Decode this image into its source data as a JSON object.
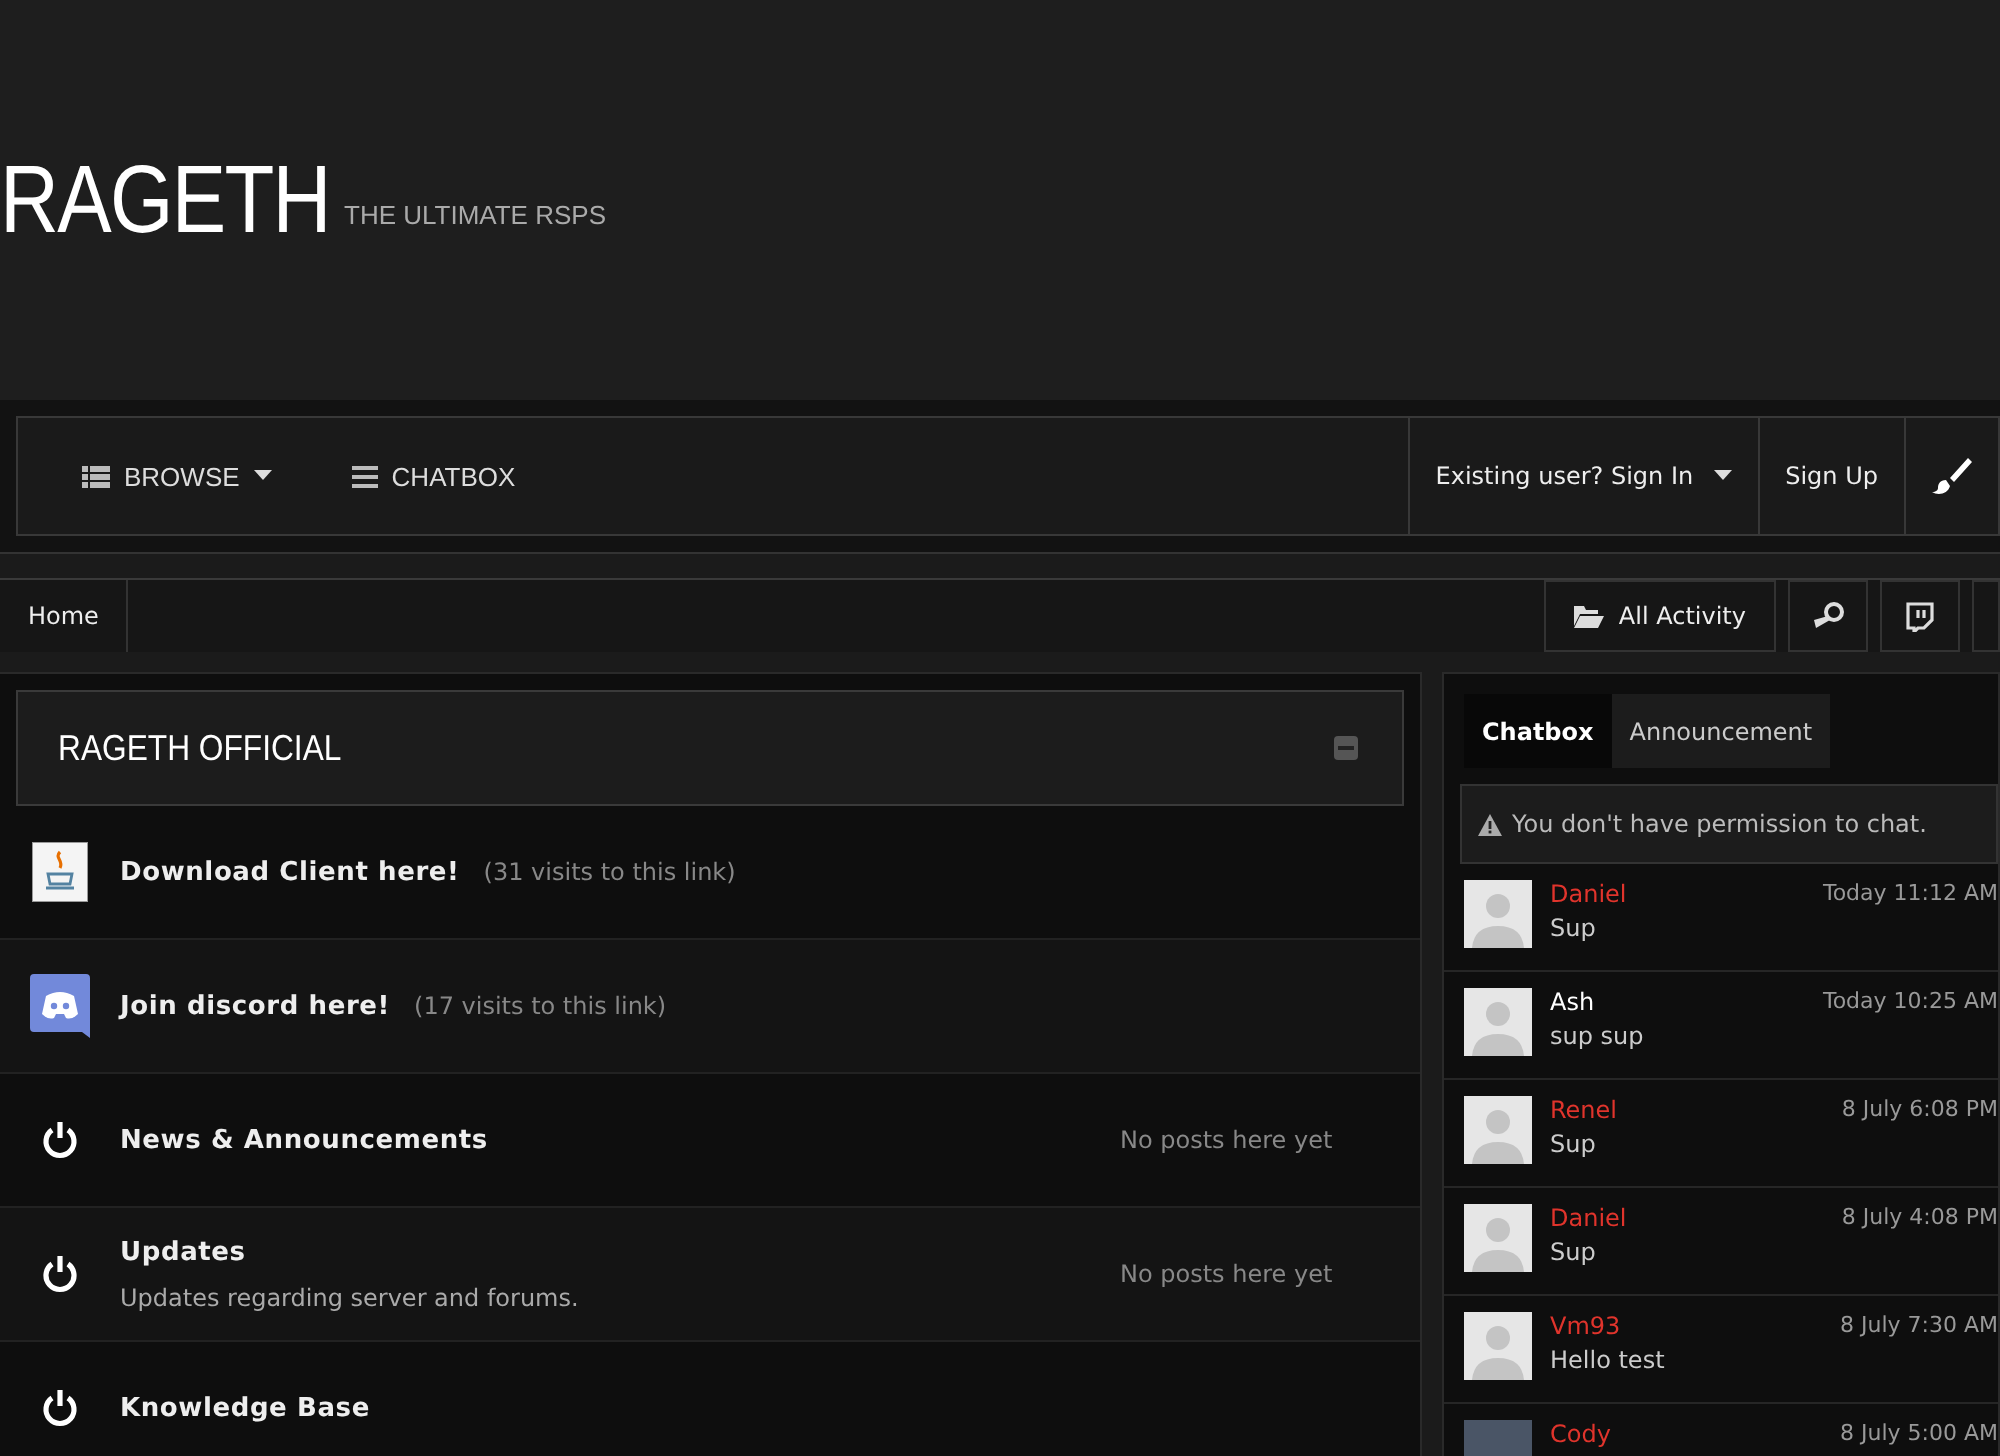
{
  "header": {
    "logo": "RAGETH",
    "tagline": "THE ULTIMATE RSPS"
  },
  "nav": {
    "items": [
      {
        "label": "BROWSE",
        "kind": "browse"
      },
      {
        "label": "CHATBOX",
        "kind": "chatbox"
      }
    ],
    "sign_in": "Existing user? Sign In",
    "sign_up": "Sign Up"
  },
  "breadcrumb": {
    "home": "Home",
    "all_activity": "All Activity"
  },
  "category": {
    "title": "RAGETH OFFICIAL",
    "forums": [
      {
        "kind": "java",
        "title": "Download Client here!",
        "visits": "(31 visits to this link)"
      },
      {
        "kind": "discord",
        "title": "Join discord here!",
        "visits": "(17 visits to this link)"
      },
      {
        "kind": "power",
        "title": "News & Announcements",
        "stat": "No posts here yet"
      },
      {
        "kind": "power",
        "title": "Updates",
        "description": "Updates regarding server and forums.",
        "stat": "No posts here yet"
      },
      {
        "kind": "power",
        "title": "Knowledge Base"
      }
    ]
  },
  "chatbox": {
    "tabs": [
      {
        "label": "Chatbox",
        "selected": true
      },
      {
        "label": "Announcement",
        "selected": false
      }
    ],
    "notice": "You don't have permission to chat.",
    "messages": [
      {
        "user": "Daniel",
        "color": "#e0342c",
        "time": "Today 11:12 AM",
        "text": "Sup"
      },
      {
        "user": "Ash",
        "color": "#ffffff",
        "time": "Today 10:25 AM",
        "text": "sup sup"
      },
      {
        "user": "Renel",
        "color": "#e0342c",
        "time": "8 July 6:08 PM",
        "text": "Sup"
      },
      {
        "user": "Daniel",
        "color": "#e0342c",
        "time": "8 July 4:08 PM",
        "text": "Sup"
      },
      {
        "user": "Vm93",
        "color": "#e0342c",
        "time": "8 July 7:30 AM",
        "text": "Hello test"
      },
      {
        "user": "Cody",
        "color": "#e0342c",
        "time": "8 July 5:00 AM",
        "photo": true
      }
    ]
  }
}
